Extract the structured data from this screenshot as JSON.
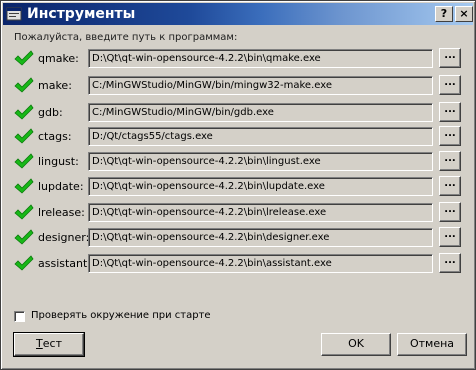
{
  "window": {
    "title": "Инструменты",
    "help_label": "?",
    "close_label": "×"
  },
  "prompt": "Пожалуйста, введите путь к программам:",
  "tools": [
    {
      "name": "qmake:",
      "path": "D:\\Qt\\qt-win-opensource-4.2.2\\bin\\qmake.exe",
      "browse_label": "..."
    },
    {
      "name": "make:",
      "path": "C:/MinGWStudio/MinGW/bin/mingw32-make.exe",
      "browse_label": "..."
    },
    {
      "name": "gdb:",
      "path": "C:/MinGWStudio/MinGW/bin/gdb.exe",
      "browse_label": "..."
    },
    {
      "name": "ctags:",
      "path": "D:/Qt/ctags55/ctags.exe",
      "browse_label": "..."
    },
    {
      "name": "lingust:",
      "path": "D:\\Qt\\qt-win-opensource-4.2.2\\bin\\lingust.exe",
      "browse_label": "..."
    },
    {
      "name": "lupdate:",
      "path": "D:\\Qt\\qt-win-opensource-4.2.2\\bin\\lupdate.exe",
      "browse_label": "..."
    },
    {
      "name": "lrelease:",
      "path": "D:\\Qt\\qt-win-opensource-4.2.2\\bin\\lrelease.exe",
      "browse_label": "..."
    },
    {
      "name": "designer:",
      "path": "D:\\Qt\\qt-win-opensource-4.2.2\\bin\\designer.exe",
      "browse_label": "..."
    },
    {
      "name": "assistant:",
      "path": "D:\\Qt\\qt-win-opensource-4.2.2\\bin\\assistant.exe",
      "browse_label": "..."
    }
  ],
  "check_environment": {
    "label": "Проверять окружение при старте",
    "checked": false
  },
  "buttons": {
    "test": "Тест",
    "ok": "OK",
    "cancel": "Отмена"
  },
  "colors": {
    "titlebar_start": "#0a246a",
    "titlebar_end": "#a6caf0",
    "dialog_bg": "#d4d0c8",
    "check_green": "#18b818"
  },
  "icons": {
    "status": "green-checkmark-icon",
    "app": "tools-app-icon"
  }
}
